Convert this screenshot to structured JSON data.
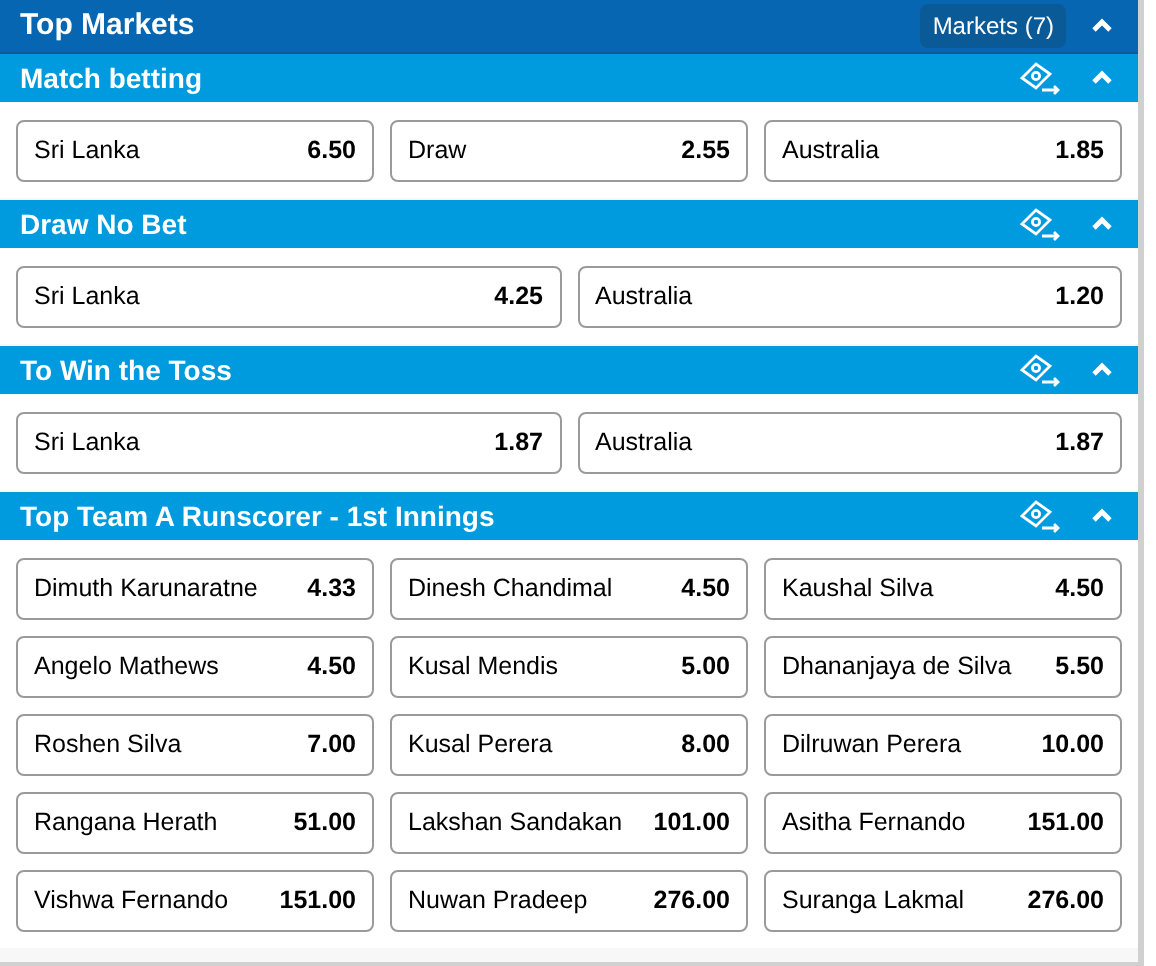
{
  "header": {
    "title": "Top Markets",
    "markets_button": "Markets (7)",
    "expanded": true
  },
  "markets": [
    {
      "title": "Match betting",
      "expanded": true,
      "selections": [
        {
          "name": "Sri Lanka",
          "odds": "6.50"
        },
        {
          "name": "Draw",
          "odds": "2.55"
        },
        {
          "name": "Australia",
          "odds": "1.85"
        }
      ]
    },
    {
      "title": "Draw No Bet",
      "expanded": true,
      "selections": [
        {
          "name": "Sri Lanka",
          "odds": "4.25"
        },
        {
          "name": "Australia",
          "odds": "1.20"
        }
      ]
    },
    {
      "title": "To Win the Toss",
      "expanded": true,
      "selections": [
        {
          "name": "Sri Lanka",
          "odds": "1.87"
        },
        {
          "name": "Australia",
          "odds": "1.87"
        }
      ]
    },
    {
      "title": "Top Team A Runscorer - 1st Innings",
      "expanded": true,
      "selections": [
        {
          "name": "Dimuth Karunaratne",
          "odds": "4.33"
        },
        {
          "name": "Dinesh Chandimal",
          "odds": "4.50"
        },
        {
          "name": "Kaushal Silva",
          "odds": "4.50"
        },
        {
          "name": "Angelo Mathews",
          "odds": "4.50"
        },
        {
          "name": "Kusal Mendis",
          "odds": "5.00"
        },
        {
          "name": "Dhananjaya de Silva",
          "odds": "5.50"
        },
        {
          "name": "Roshen Silva",
          "odds": "7.00"
        },
        {
          "name": "Kusal Perera",
          "odds": "8.00"
        },
        {
          "name": "Dilruwan Perera",
          "odds": "10.00"
        },
        {
          "name": "Rangana Herath",
          "odds": "51.00"
        },
        {
          "name": "Lakshan Sandakan",
          "odds": "101.00"
        },
        {
          "name": "Asitha Fernando",
          "odds": "151.00"
        },
        {
          "name": "Vishwa Fernando",
          "odds": "151.00"
        },
        {
          "name": "Nuwan Pradeep",
          "odds": "276.00"
        },
        {
          "name": "Suranga Lakmal",
          "odds": "276.00"
        }
      ]
    }
  ]
}
